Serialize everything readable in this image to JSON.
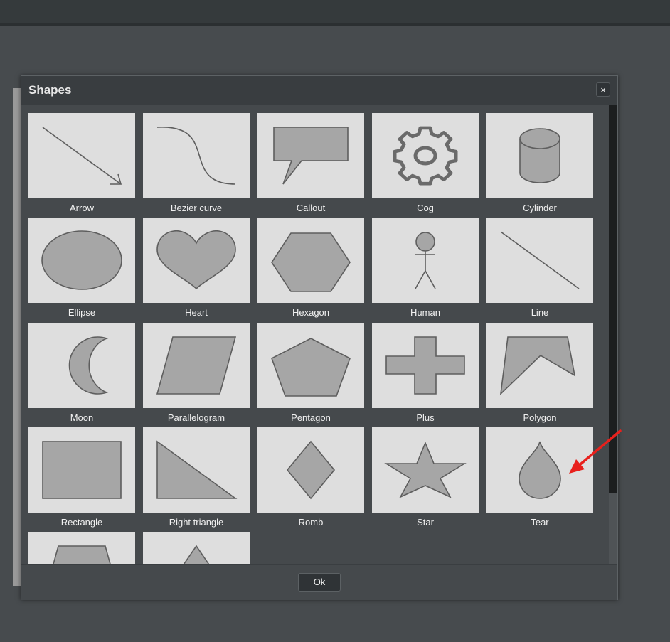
{
  "dialog": {
    "title": "Shapes",
    "close_label": "×",
    "ok_label": "Ok"
  },
  "shapes": [
    {
      "label": "Arrow",
      "icon": "arrow-shape-icon"
    },
    {
      "label": "Bezier curve",
      "icon": "bezier-curve-shape-icon"
    },
    {
      "label": "Callout",
      "icon": "callout-shape-icon"
    },
    {
      "label": "Cog",
      "icon": "cog-shape-icon"
    },
    {
      "label": "Cylinder",
      "icon": "cylinder-shape-icon"
    },
    {
      "label": "Ellipse",
      "icon": "ellipse-shape-icon"
    },
    {
      "label": "Heart",
      "icon": "heart-shape-icon"
    },
    {
      "label": "Hexagon",
      "icon": "hexagon-shape-icon"
    },
    {
      "label": "Human",
      "icon": "human-shape-icon"
    },
    {
      "label": "Line",
      "icon": "line-shape-icon"
    },
    {
      "label": "Moon",
      "icon": "moon-shape-icon"
    },
    {
      "label": "Parallelogram",
      "icon": "parallelogram-shape-icon"
    },
    {
      "label": "Pentagon",
      "icon": "pentagon-shape-icon"
    },
    {
      "label": "Plus",
      "icon": "plus-shape-icon"
    },
    {
      "label": "Polygon",
      "icon": "polygon-shape-icon"
    },
    {
      "label": "Rectangle",
      "icon": "rectangle-shape-icon"
    },
    {
      "label": "Right triangle",
      "icon": "right-triangle-shape-icon"
    },
    {
      "label": "Romb",
      "icon": "romb-shape-icon"
    },
    {
      "label": "Star",
      "icon": "star-shape-icon"
    },
    {
      "label": "Tear",
      "icon": "tear-shape-icon"
    },
    {
      "label": "",
      "icon": "trapezoid-shape-icon"
    },
    {
      "label": "",
      "icon": "triangle-shape-icon"
    }
  ],
  "colors": {
    "annotation_arrow": "#e8201c",
    "thumb_bg": "#dedede",
    "shape_fill": "#a6a6a6",
    "shape_stroke": "#5e5e5e"
  }
}
